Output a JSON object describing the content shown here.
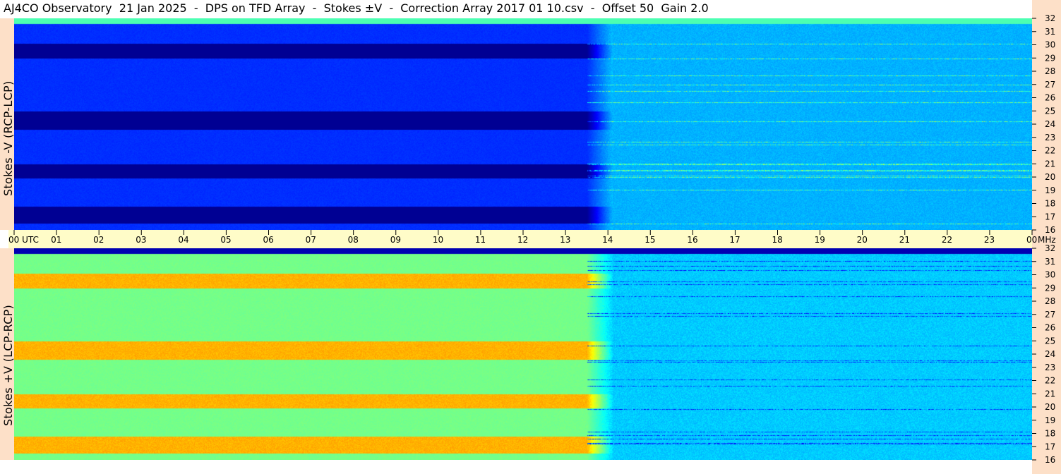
{
  "title": "AJ4CO Observatory  21 Jan 2025  -  DPS on TFD Array  -  Stokes ±V  -  Correction Array 2017 01 10.csv  -  Offset 50  Gain 2.0",
  "chart_data": [
    {
      "type": "heatmap",
      "panel": "top",
      "ylabel": "Stokes -V (RCP-LCP)",
      "x_ticks": [
        "00  UTC",
        "01",
        "02",
        "03",
        "04",
        "05",
        "06",
        "07",
        "08",
        "09",
        "10",
        "11",
        "12",
        "13",
        "14",
        "15",
        "16",
        "17",
        "18",
        "19",
        "20",
        "21",
        "22",
        "23",
        "00"
      ],
      "x_range_hours": [
        0,
        24
      ],
      "y_ticks": [
        "16",
        "17",
        "18",
        "19",
        "20",
        "21",
        "22",
        "23",
        "24",
        "25",
        "26",
        "27",
        "28",
        "29",
        "30",
        "31",
        "32"
      ],
      "y_range_mhz": [
        16,
        32
      ],
      "dark_bands_mhz": [
        [
          29.0,
          30.1
        ],
        [
          23.6,
          25.0
        ],
        [
          19.9,
          21.0
        ],
        [
          16.5,
          17.8
        ]
      ]
    },
    {
      "type": "heatmap",
      "panel": "bottom",
      "ylabel": "Stokes +V (LCP-RCP)",
      "x_ticks": [
        "00  UTC",
        "01",
        "02",
        "03",
        "04",
        "05",
        "06",
        "07",
        "08",
        "09",
        "10",
        "11",
        "12",
        "13",
        "14",
        "15",
        "16",
        "17",
        "18",
        "19",
        "20",
        "21",
        "22",
        "23",
        "00"
      ],
      "x_range_hours": [
        0,
        24
      ],
      "y_ticks": [
        "16",
        "17",
        "18",
        "19",
        "20",
        "21",
        "22",
        "23",
        "24",
        "25",
        "26",
        "27",
        "28",
        "29",
        "30",
        "31",
        "32"
      ],
      "y_range_mhz": [
        16,
        32
      ],
      "hot_bands_mhz": [
        [
          29.0,
          30.1
        ],
        [
          23.6,
          25.0
        ],
        [
          19.9,
          21.0
        ],
        [
          16.5,
          17.8
        ]
      ]
    }
  ],
  "axis": {
    "unit": "MHz"
  },
  "colors": {
    "strip": "#fde0c8",
    "axis_band": "#fffcc8"
  }
}
